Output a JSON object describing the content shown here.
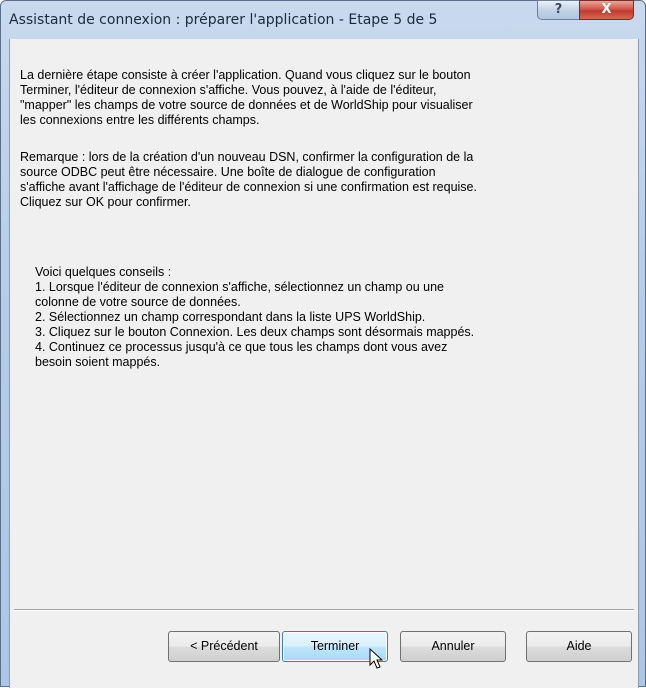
{
  "window": {
    "title": "Assistant de connexion : préparer l'application - Etape 5 de 5",
    "help_glyph": "?",
    "close_glyph": "X"
  },
  "content": {
    "paragraph1": "La dernière étape consiste à créer l'application. Quand vous cliquez sur le bouton\nTerminer, l'éditeur de connexion s'affiche. Vous pouvez, à l'aide de l'éditeur,\n\"mapper\" les champs de votre source de données et de WorldShip pour visualiser\nles connexions entre les différents champs.",
    "paragraph2": "Remarque : lors de la création d'un nouveau DSN, confirmer la configuration de la\nsource ODBC peut être nécessaire. Une boîte de dialogue de configuration\ns'affiche avant l'affichage de l'éditeur de connexion si une confirmation est requise.\n Cliquez sur OK pour confirmer.",
    "tips": "Voici quelques conseils :\n1. Lorsque l'éditeur de connexion s'affiche, sélectionnez un champ ou une\ncolonne de votre source de données.\n2. Sélectionnez un champ correspondant dans la liste UPS WorldShip.\n3. Cliquez sur le bouton Connexion. Les deux champs sont désormais mappés.\n4. Continuez ce processus jusqu'à ce que tous les champs dont vous avez\nbesoin soient mappés."
  },
  "buttons": {
    "previous": "< Précédent",
    "finish": "Terminer",
    "cancel": "Annuler",
    "help": "Aide"
  }
}
